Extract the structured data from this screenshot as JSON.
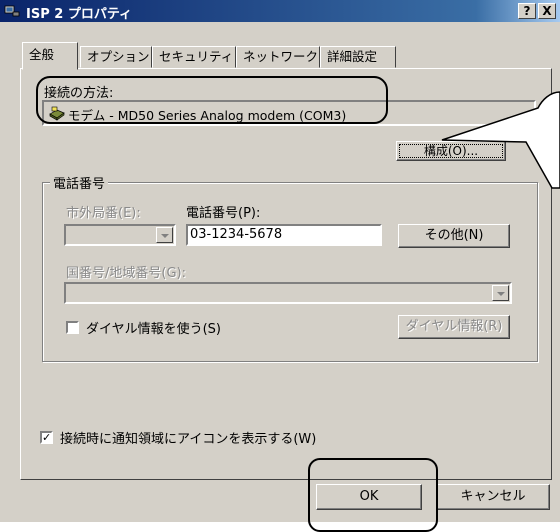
{
  "window": {
    "title": "ISP 2 プロパティ",
    "help_label": "?",
    "close_label": "X"
  },
  "tabs": [
    {
      "label": "全般"
    },
    {
      "label": "オプション"
    },
    {
      "label": "セキュリティ"
    },
    {
      "label": "ネットワーク"
    },
    {
      "label": "詳細設定"
    }
  ],
  "connect": {
    "label": "接続の方法:",
    "device": "モデム - MD50 Series  Analog modem (COM3)",
    "configure_label": "構成(O)..."
  },
  "phone": {
    "group_title": "電話番号",
    "area_code_label": "市外局番(E):",
    "number_label": "電話番号(P):",
    "number_value": "03-1234-5678",
    "other_button": "その他(N)",
    "country_label": "国番号/地域番号(G):",
    "use_dialing_rules": "ダイヤル情報を使う(S)",
    "dialing_rules_button": "ダイヤル情報(R)"
  },
  "notify": {
    "label": "接続時に通知領域にアイコンを表示する(W)",
    "checked": "✓"
  },
  "footer": {
    "ok": "OK",
    "cancel": "キャンセル"
  }
}
